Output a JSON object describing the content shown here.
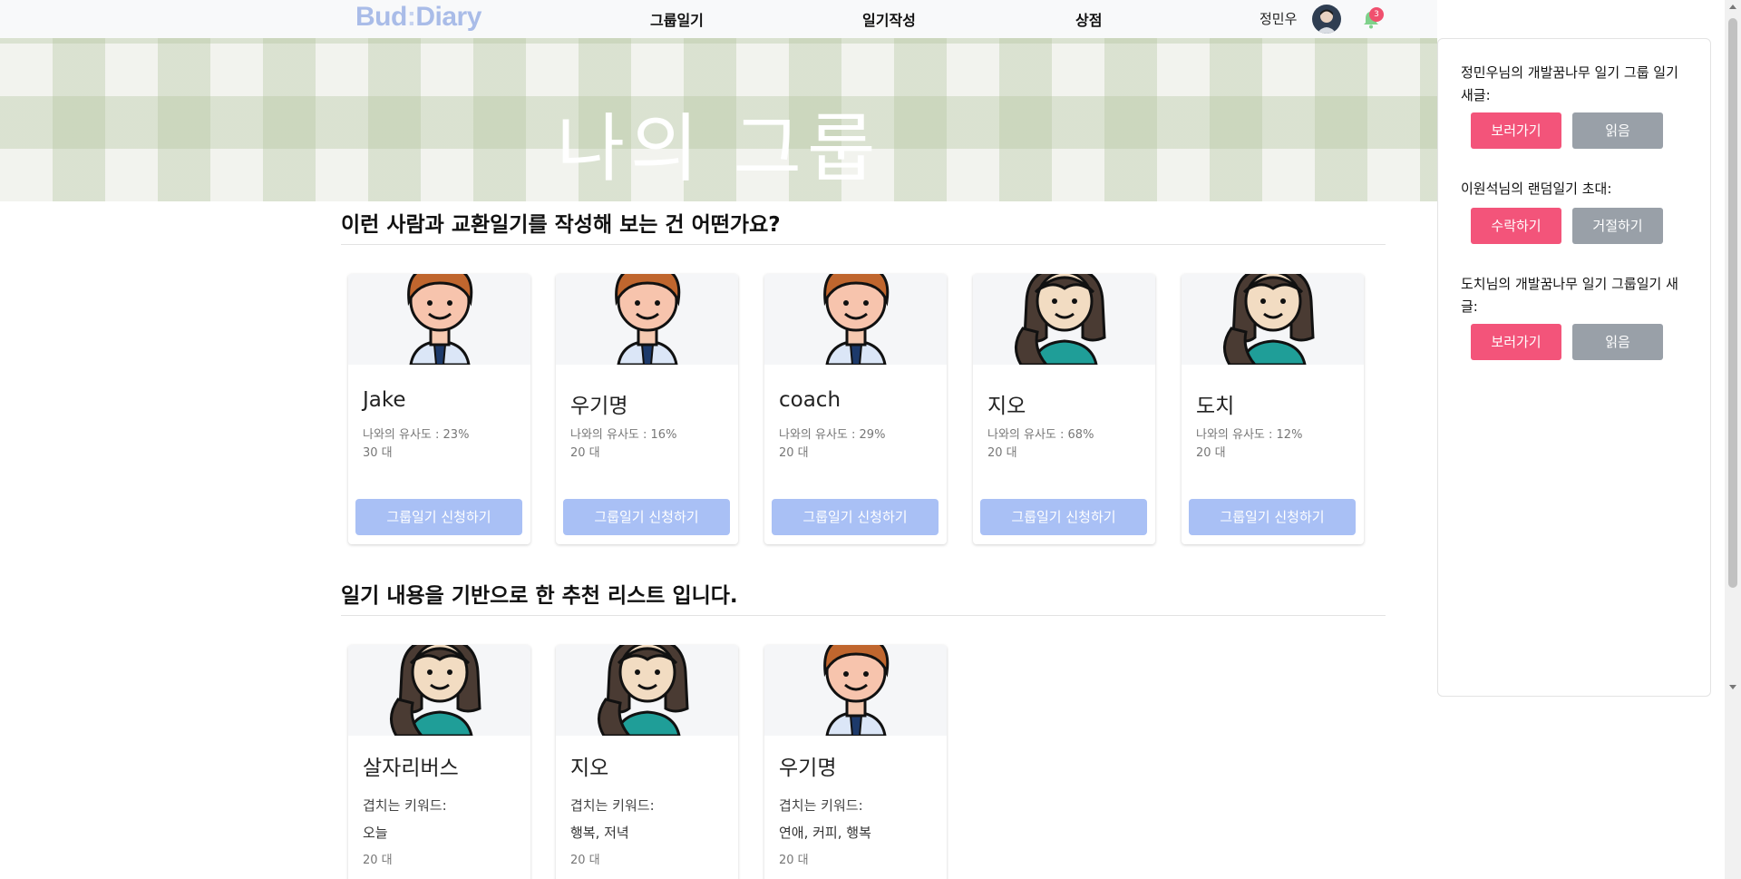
{
  "app": {
    "logo_left": "Bud",
    "logo_colon": ":",
    "logo_right": "Diary"
  },
  "nav": {
    "items": [
      "그룹일기",
      "일기작성",
      "상점"
    ]
  },
  "user": {
    "name": "정민우",
    "notification_count": "3"
  },
  "hero": {
    "title": "나의 그룹"
  },
  "similar": {
    "title": "이런 사람과 교환일기를 작성해 보는 건 어떤가요?",
    "cards": [
      {
        "name": "Jake",
        "similarity": "나와의 유사도 : 23%",
        "age": "30 대",
        "button": "그룹일기 신청하기",
        "avatar": "male"
      },
      {
        "name": "우기명",
        "similarity": "나와의 유사도 : 16%",
        "age": "20 대",
        "button": "그룹일기 신청하기",
        "avatar": "male"
      },
      {
        "name": "coach",
        "similarity": "나와의 유사도 : 29%",
        "age": "20 대",
        "button": "그룹일기 신청하기",
        "avatar": "male"
      },
      {
        "name": "지오",
        "similarity": "나와의 유사도 : 68%",
        "age": "20 대",
        "button": "그룹일기 신청하기",
        "avatar": "female"
      },
      {
        "name": "도치",
        "similarity": "나와의 유사도 : 12%",
        "age": "20 대",
        "button": "그룹일기 신청하기",
        "avatar": "female"
      }
    ]
  },
  "keyword": {
    "title": "일기 내용을 기반으로 한 추천 리스트 입니다.",
    "cards": [
      {
        "name": "살자리버스",
        "label": "겹치는 키워드:",
        "keywords": "오늘",
        "age": "20 대",
        "avatar": "female"
      },
      {
        "name": "지오",
        "label": "겹치는 키워드:",
        "keywords": "행복, 저녁",
        "age": "20 대",
        "avatar": "female"
      },
      {
        "name": "우기명",
        "label": "겹치는 키워드:",
        "keywords": "연애, 커피, 행복",
        "age": "20 대",
        "avatar": "male"
      }
    ]
  },
  "notifications": [
    {
      "text": "정민우님의 개발꿈나무 일기 그룹 일기 새글:",
      "primary": "보러가기",
      "secondary": "읽음"
    },
    {
      "text": "이원석님의 랜덤일기 초대:",
      "primary": "수락하기",
      "secondary": "거절하기"
    },
    {
      "text": "도치님의 개발꿈나무 일기 그룹일기 새글:",
      "primary": "보러가기",
      "secondary": "읽음"
    }
  ],
  "colors": {
    "accent": "#f3547a",
    "muted_button": "#99a0a8",
    "card_button": "#a9c0f5",
    "logo": "#a9bce8"
  }
}
